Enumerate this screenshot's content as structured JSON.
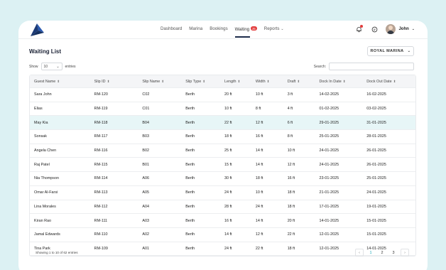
{
  "nav": {
    "items": [
      "Dashboard",
      "Marina",
      "Bookings",
      "Waiting",
      "Reports"
    ],
    "waiting_badge": "25",
    "user_name": "John"
  },
  "page": {
    "title": "Waiting List",
    "marina_select": "ROYAL MARINA",
    "show_label": "Show",
    "entries_value": "10",
    "entries_label": "entries",
    "search_label": "Search:"
  },
  "table": {
    "columns": [
      "Guest Name",
      "Slip ID",
      "Slip Name",
      "Slip Type",
      "Length",
      "Width",
      "Draft",
      "Dock In Date",
      "Dock Out Date"
    ],
    "rows": [
      [
        "Sara John",
        "RM-120",
        "C02",
        "Berth",
        "20 ft",
        "10 ft",
        "3 ft",
        "14-02-2025",
        "16-02-2025"
      ],
      [
        "Elias",
        "RM-119",
        "C01",
        "Berth",
        "10 ft",
        "8 ft",
        "4 ft",
        "01-02-2025",
        "03-02-2025"
      ],
      [
        "May Kia",
        "RM-118",
        "B04",
        "Berth",
        "22 ft",
        "12 ft",
        "6 ft",
        "29-01-2025",
        "31-01-2025"
      ],
      [
        "Sonsak",
        "RM-117",
        "B03",
        "Berth",
        "18 ft",
        "16 ft",
        "8 ft",
        "25-01-2025",
        "28-01-2025"
      ],
      [
        "Angela Chen",
        "RM-116",
        "B02",
        "Berth",
        "25 ft",
        "14 ft",
        "10 ft",
        "24-01-2025",
        "26-01-2025"
      ],
      [
        "Raj Patel",
        "RM-115",
        "B01",
        "Berth",
        "15 ft",
        "14 ft",
        "12 ft",
        "24-01-2025",
        "26-01-2025"
      ],
      [
        "Nia Thompson",
        "RM-114",
        "A06",
        "Berth",
        "30 ft",
        "18 ft",
        "16 ft",
        "23-01-2025",
        "25-01-2025"
      ],
      [
        "Omar Al-Farsi",
        "RM-113",
        "A05",
        "Berth",
        "24 ft",
        "10 ft",
        "18 ft",
        "21-01-2025",
        "24-01-2025"
      ],
      [
        "Lina Morales",
        "RM-112",
        "A04",
        "Berth",
        "28 ft",
        "24 ft",
        "18 ft",
        "17-01-2025",
        "19-01-2025"
      ],
      [
        "Kiran Rao",
        "RM-111",
        "A03",
        "Berth",
        "16 ft",
        "14 ft",
        "20 ft",
        "14-01-2025",
        "15-01-2025"
      ],
      [
        "Jamal Edwards",
        "RM-110",
        "A02",
        "Berth",
        "14 ft",
        "12 ft",
        "22 ft",
        "12-01-2025",
        "15-01-2025"
      ],
      [
        "Tina Park",
        "RM-109",
        "A01",
        "Berth",
        "24 ft",
        "22 ft",
        "18 ft",
        "12-01-2025",
        "14-01-2025"
      ]
    ],
    "highlighted_row": 2
  },
  "footer": {
    "info": "Showing 1 to 10 of 62 entries",
    "pages": [
      "1",
      "2",
      "3"
    ],
    "active_page": "1",
    "prev": "‹",
    "next": "›"
  },
  "colors": {
    "background": "#dcf1f3",
    "accent": "#19a8b8",
    "highlight_row": "#e7f6f7",
    "badge": "#e23b3b",
    "logo": "#1c3a75"
  }
}
